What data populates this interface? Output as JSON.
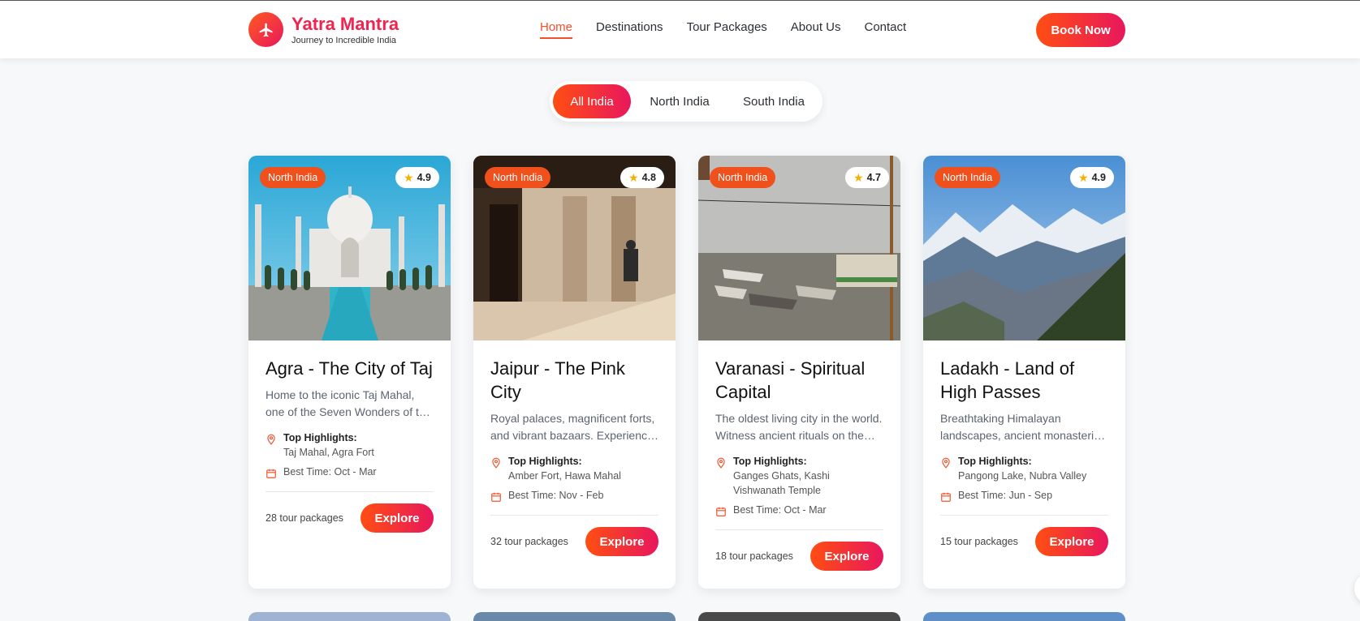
{
  "brand": {
    "title": "Yatra Mantra",
    "subtitle": "Journey to Incredible India"
  },
  "nav": {
    "items": [
      "Home",
      "Destinations",
      "Tour Packages",
      "About Us",
      "Contact"
    ],
    "active": "Home"
  },
  "header": {
    "book_label": "Book Now"
  },
  "filters": {
    "items": [
      "All India",
      "North India",
      "South India"
    ],
    "active": "All India"
  },
  "labels": {
    "highlights": "Top Highlights:",
    "explore": "Explore"
  },
  "cards": [
    {
      "region": "North India",
      "rating": "4.9",
      "title": "Agra - The City of Taj",
      "desc": "Home to the iconic Taj Mahal, one of the Seven Wonders of the World.",
      "highlights": "Taj Mahal, Agra Fort",
      "best_time": "Best Time: Oct - Mar",
      "packages": "28 tour packages"
    },
    {
      "region": "North India",
      "rating": "4.8",
      "title": "Jaipur - The Pink City",
      "desc": "Royal palaces, magnificent forts, and vibrant bazaars. Experience royal heritage.",
      "highlights": "Amber Fort, Hawa Mahal",
      "best_time": "Best Time: Nov - Feb",
      "packages": "32 tour packages"
    },
    {
      "region": "North India",
      "rating": "4.7",
      "title": "Varanasi - Spiritual Capital",
      "desc": "The oldest living city in the world. Witness ancient rituals on the ghats.",
      "highlights": "Ganges Ghats, Kashi Vishwanath Temple",
      "best_time": "Best Time: Oct - Mar",
      "packages": "18 tour packages"
    },
    {
      "region": "North India",
      "rating": "4.9",
      "title": "Ladakh - Land of High Passes",
      "desc": "Breathtaking Himalayan landscapes, ancient monasteries and high passes.",
      "highlights": "Pangong Lake, Nubra Valley",
      "best_time": "Best Time: Jun - Sep",
      "packages": "15 tour packages"
    }
  ],
  "colors": {
    "accent": "#f0512b",
    "gradient_start": "#ff4e12",
    "gradient_end": "#e8175d"
  }
}
